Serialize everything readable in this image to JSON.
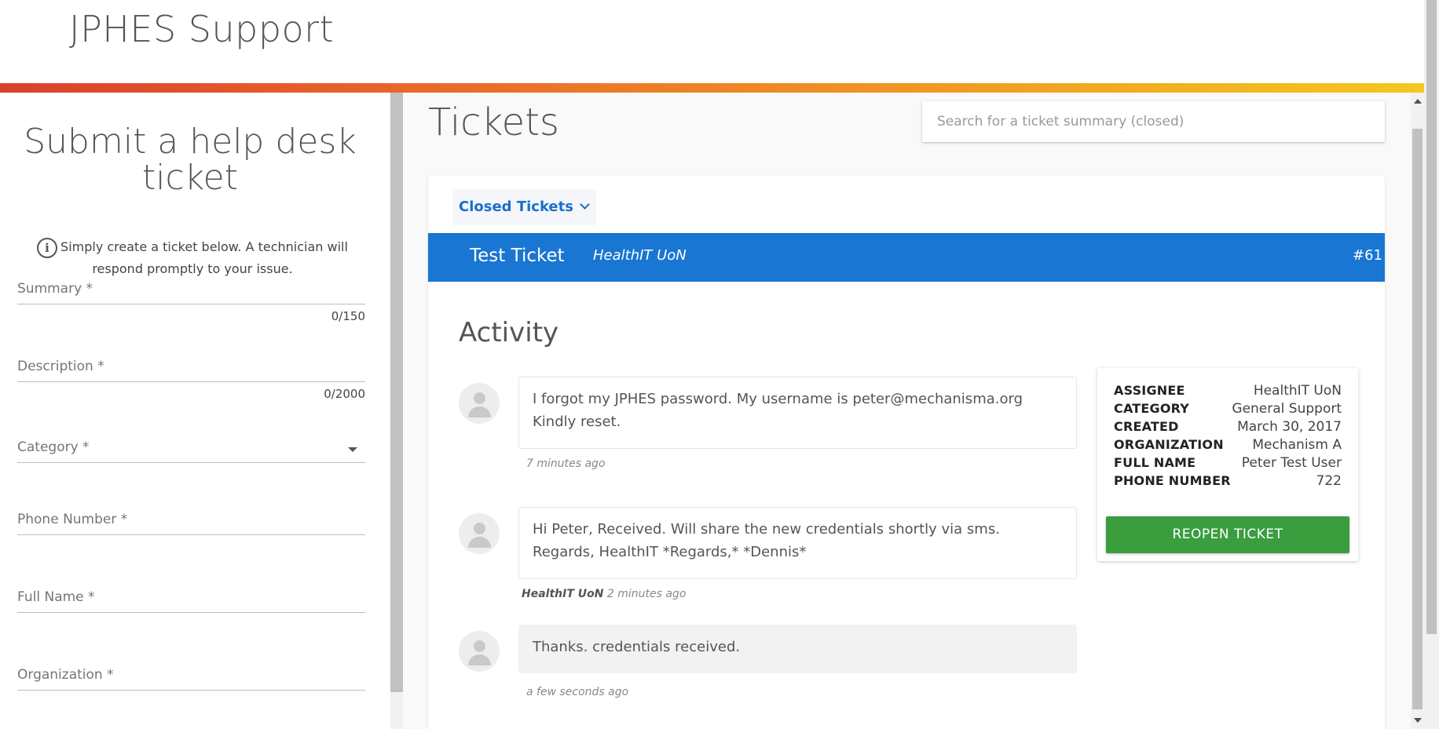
{
  "header": {
    "title": "JPHES Support"
  },
  "form": {
    "title": "Submit a help desk ticket",
    "info_icon": "info-icon",
    "info_text": "Simply create a ticket below. A technician will respond promptly to your issue.",
    "fields": {
      "summary": {
        "label": "Summary *",
        "counter": "0/150"
      },
      "description": {
        "label": "Description *",
        "counter": "0/2000"
      },
      "category": {
        "label": "Category *"
      },
      "phone": {
        "label": "Phone Number *"
      },
      "full_name": {
        "label": "Full Name *"
      },
      "organization": {
        "label": "Organization *"
      }
    }
  },
  "tickets": {
    "heading": "Tickets",
    "search_placeholder": "Search for a ticket summary (closed)",
    "filter_label": "Closed Tickets",
    "ticket": {
      "title": "Test Ticket",
      "organization": "HealthIT UoN",
      "number": "#61"
    },
    "activity_heading": "Activity",
    "messages": [
      {
        "text": "I forgot my JPHES password. My username is peter@mechanisma.org Kindly reset.",
        "author": "",
        "time": "7 minutes ago"
      },
      {
        "text": "Hi Peter, Received. Will share the new credentials shortly via sms. Regards, HealthIT *Regards,* *Dennis*",
        "author": "HealthIT UoN",
        "time": "2 minutes ago"
      },
      {
        "text": "Thanks. credentials received.",
        "author": "",
        "time": "a few seconds ago"
      }
    ],
    "details": [
      {
        "key": "ASSIGNEE",
        "value": "HealthIT UoN"
      },
      {
        "key": "CATEGORY",
        "value": "General Support"
      },
      {
        "key": "CREATED",
        "value": "March 30, 2017"
      },
      {
        "key": "ORGANIZATION",
        "value": "Mechanism A"
      },
      {
        "key": "FULL NAME",
        "value": "Peter Test User"
      },
      {
        "key": "PHONE NUMBER",
        "value": "722"
      }
    ],
    "reopen_label": "REOPEN TICKET"
  },
  "colors": {
    "accent": "#1976d2",
    "success": "#3a9d3e",
    "brand_gradient_start": "#d9402b",
    "brand_gradient_end": "#f4c71f"
  }
}
